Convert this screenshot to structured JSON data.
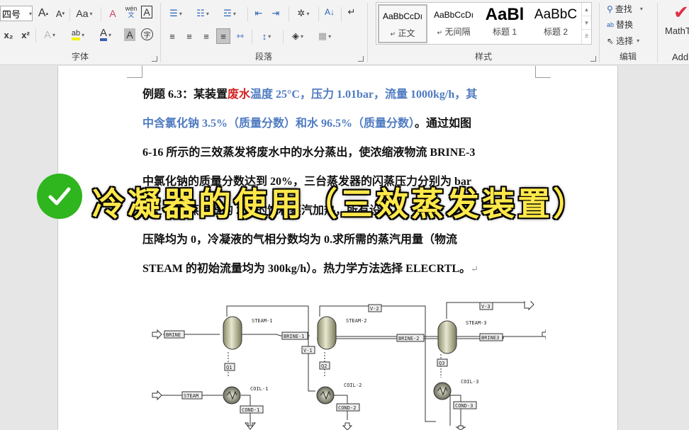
{
  "ribbon": {
    "font_group": {
      "label": "字体",
      "font_size": "四号",
      "grow_font": "A",
      "shrink_font": "A",
      "change_case": "Aa",
      "phonetic_guide": "wén",
      "phonetic_char": "文",
      "char_border": "A",
      "subscript": "x₂",
      "superscript": "x²",
      "text_effects": "A",
      "highlight": "ab",
      "font_color": "A",
      "char_shading": "A",
      "enclose_char": "字"
    },
    "paragraph_group": {
      "label": "段落"
    },
    "styles_group": {
      "label": "样式",
      "items": [
        {
          "preview": "AaBbCcDı",
          "name": "正文",
          "mark": "↵",
          "selected": true
        },
        {
          "preview": "AaBbCcDı",
          "name": "无间隔",
          "mark": "↵",
          "selected": false
        },
        {
          "preview": "AaBl",
          "name": "标题 1",
          "mark": "",
          "selected": false
        },
        {
          "preview": "AaBbC",
          "name": "标题 2",
          "mark": "",
          "selected": false
        }
      ]
    },
    "editing_group": {
      "label": "编辑",
      "find": "查找",
      "replace": "替换",
      "select": "选择"
    },
    "addins_group": {
      "label": "Add",
      "mathtype": "MathT"
    }
  },
  "document": {
    "line1": {
      "prefix": "例题 6.3：某装置",
      "red": "废水",
      "blue": "温度 25°C，压力 1.01bar，流量 1000kg/h，其"
    },
    "line2": {
      "blue": "中含氯化钠 3.5%（质量分数）和水 96.5%（质量分数）",
      "suffix": "。通过如图"
    },
    "line3": "6-16 所示的三效蒸发将废水中的水分蒸出，使浓缩液物流 BRINE-3",
    "line4": "中氯化钠的质量分数达到 20%，三台蒸发器的闪蒸压力分别为 bar",
    "line5": "、、，三台蒸发器的 200 的饱和蒸汽加热，所有设备",
    "line6": "压降均为 0，冷凝液的气相分数均为 0.求所需的蒸汽用量（物流",
    "line7": "STEAM 的初始流量均为 300kg/h）。热力学方法选择 ELECRTL。",
    "para_mark": "↵"
  },
  "overlay": {
    "title": "冷凝器的使用（三效蒸发装置）",
    "check_color": "#2fb51d",
    "title_color": "#ffe84a"
  },
  "diagram": {
    "streams": {
      "brine": "BRINE",
      "brine1": "BRINE-1",
      "brine2": "BRINE-2",
      "brine3": "BRINE3",
      "steam": "STEAM",
      "v1": "V-1",
      "v2": "V-2",
      "v3": "V-3",
      "q1": "Q1",
      "q2": "Q2",
      "q3": "Q3",
      "cond1": "COND-1",
      "cond2": "COND-2",
      "cond3": "COND-3"
    },
    "blocks": {
      "steam1": "STEAM-1",
      "steam2": "STEAM-2",
      "steam3": "STEAM-3",
      "coil1": "COIL-1",
      "coil2": "COIL-2",
      "coil3": "COIL-3"
    }
  }
}
